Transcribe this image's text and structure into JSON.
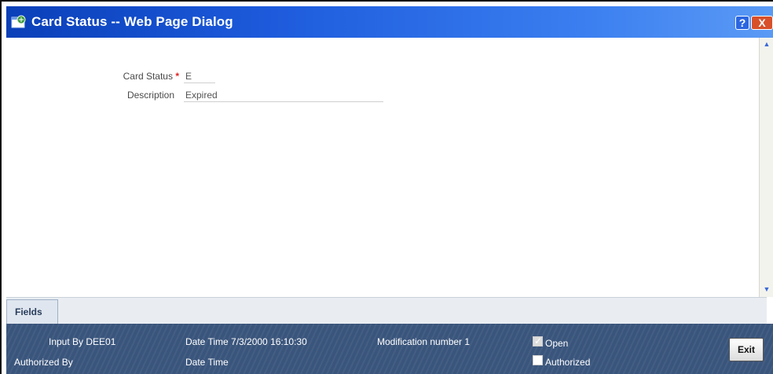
{
  "window": {
    "title": "Card Status -- Web Page Dialog",
    "help_glyph": "?",
    "close_glyph": "X"
  },
  "form": {
    "card_status": {
      "label": "Card Status",
      "required_mark": "*",
      "value": "E"
    },
    "description": {
      "label": "Description",
      "value": "Expired"
    }
  },
  "tabs": [
    {
      "label": "Fields"
    }
  ],
  "audit": {
    "input_by": "Input By DEE01",
    "authorized_by": "Authorized By",
    "date_time_input": "Date Time 7/3/2000 16:10:30",
    "date_time_auth": "Date Time",
    "modification": "Modification number 1",
    "open": {
      "label": "Open",
      "checked": true
    },
    "authorized": {
      "label": "Authorized",
      "checked": false
    },
    "exit_label": "Exit"
  },
  "colors": {
    "title_bar": "#1d5bdc",
    "footer": "#3a557c",
    "required": "#e02020"
  }
}
